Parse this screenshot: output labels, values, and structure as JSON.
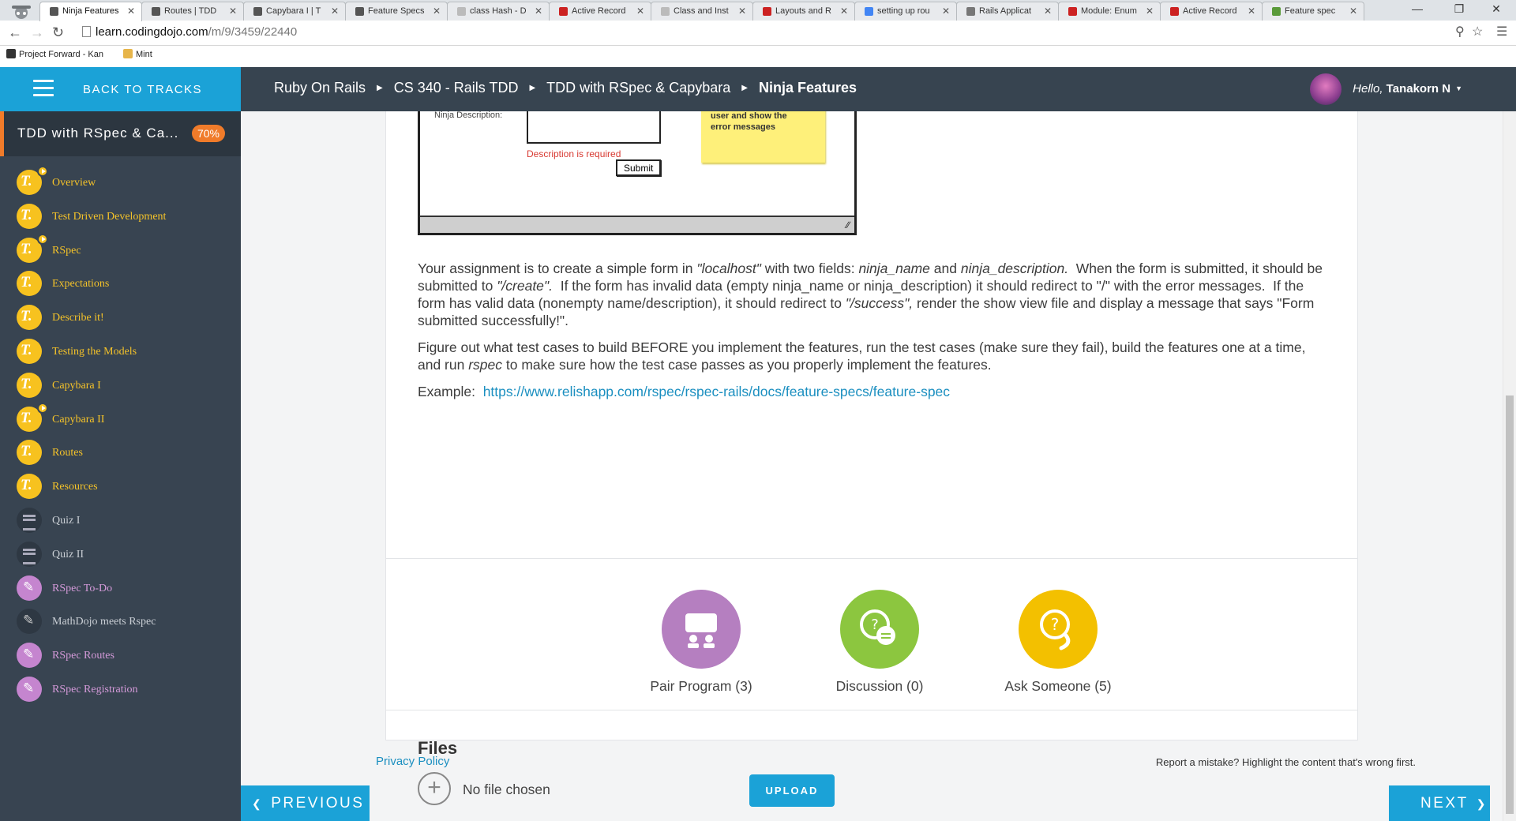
{
  "browser": {
    "tabs": [
      {
        "title": "Ninja Features",
        "color": "#555555",
        "active": true
      },
      {
        "title": "Routes | TDD",
        "color": "#555555"
      },
      {
        "title": "Capybara I | T",
        "color": "#555555"
      },
      {
        "title": "Feature Specs",
        "color": "#555555"
      },
      {
        "title": "class Hash - D",
        "color": "#bbbbbb"
      },
      {
        "title": "Active Record",
        "color": "#cc2222"
      },
      {
        "title": "Class and Inst",
        "color": "#bbbbbb"
      },
      {
        "title": "Layouts and R",
        "color": "#cc2222"
      },
      {
        "title": "setting up rou",
        "color": "#4285f4"
      },
      {
        "title": "Rails Applicat",
        "color": "#777777"
      },
      {
        "title": "Module: Enum",
        "color": "#cc2222"
      },
      {
        "title": "Active Record",
        "color": "#cc2222"
      },
      {
        "title": "Feature spec",
        "color": "#5a9a3a"
      }
    ],
    "url_host": "learn.codingdojo.com",
    "url_path": "/m/9/3459/22440",
    "bookmarks": [
      {
        "label": "Project Forward - Kan",
        "color": "#333333"
      },
      {
        "label": "Mint",
        "color": "#e7b54a"
      }
    ]
  },
  "topnav": {
    "back_label": "BACK TO TRACKS",
    "crumbs": [
      "Ruby On Rails",
      "CS 340 - Rails TDD",
      "TDD with RSpec & Capybara"
    ],
    "current": "Ninja Features",
    "hello": "Hello,",
    "username": "Tanakorn N"
  },
  "sidebar": {
    "course_title": "TDD with RSpec & Ca...",
    "progress": "70%",
    "items": [
      {
        "label": "Overview",
        "icon": "t",
        "play": true,
        "color": "y"
      },
      {
        "label": "Test Driven Development",
        "icon": "t",
        "play": false,
        "color": "y"
      },
      {
        "label": "RSpec",
        "icon": "t",
        "play": true,
        "color": "y"
      },
      {
        "label": "Expectations",
        "icon": "t",
        "play": false,
        "color": "y"
      },
      {
        "label": "Describe it!",
        "icon": "t",
        "play": false,
        "color": "y"
      },
      {
        "label": "Testing the Models",
        "icon": "t",
        "play": false,
        "color": "y"
      },
      {
        "label": "Capybara I",
        "icon": "t",
        "play": false,
        "color": "y"
      },
      {
        "label": "Capybara II",
        "icon": "t",
        "play": true,
        "color": "y"
      },
      {
        "label": "Routes",
        "icon": "t",
        "play": false,
        "color": "y"
      },
      {
        "label": "Resources",
        "icon": "t",
        "play": false,
        "color": "y"
      },
      {
        "label": "Quiz I",
        "icon": "q",
        "play": false,
        "color": "g"
      },
      {
        "label": "Quiz II",
        "icon": "q",
        "play": false,
        "color": "g"
      },
      {
        "label": "RSpec To-Do",
        "icon": "p",
        "play": false,
        "color": "p"
      },
      {
        "label": "MathDojo meets Rspec",
        "icon": "pd",
        "play": false,
        "color": "g"
      },
      {
        "label": "RSpec Routes",
        "icon": "p",
        "play": false,
        "color": "p"
      },
      {
        "label": "RSpec Registration",
        "icon": "p",
        "play": false,
        "color": "p"
      }
    ]
  },
  "mockup": {
    "label": "Ninja Description:",
    "error": "Description is required",
    "submit": "Submit",
    "sticky_note": "user and show the error messages"
  },
  "content": {
    "para1": "Your assignment is to create a simple form in <i>\"localhost\"</i> with two fields: <i>ninja_name</i> and <i>ninja_description.</i>&nbsp; When the form is submitted, it should be submitted to <i>\"/create\".</i>&nbsp; If the form has invalid data (empty ninja_name or ninja_description) it should redirect to \"/\" with the error messages.&nbsp; If the form has valid data (nonempty name/description), it should redirect to <i>\"/success\",</i> render the show view file and display a message that says \"Form submitted successfully!\".",
    "para2": "Figure out what test cases to build BEFORE you implement the features, run the test cases (make sure they fail), build the features one at a time, and run <i>rspec</i> to make sure how the test case passes as you properly implement the features.",
    "example_label": "Example:",
    "example_link": "https://www.relishapp.com/rspec/rspec-rails/docs/feature-specs/feature-spec"
  },
  "actions": [
    {
      "label": "Pair Program (3)",
      "color": "#b57fc0"
    },
    {
      "label": "Discussion (0)",
      "color": "#8cc63f"
    },
    {
      "label": "Ask Someone (5)",
      "color": "#f3c000"
    }
  ],
  "files": {
    "title": "Files",
    "no_file": "No file chosen",
    "upload": "UPLOAD"
  },
  "footer": {
    "privacy": "Privacy Policy",
    "report": "Report a mistake? Highlight the content that's wrong first.",
    "previous": "PREVIOUS",
    "next": "NEXT"
  }
}
